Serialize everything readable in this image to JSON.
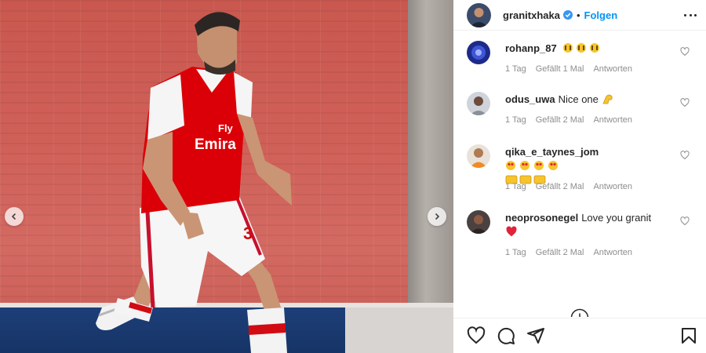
{
  "post": {
    "username": "granitxhaka",
    "follow_label": "Folgen",
    "separator": "•"
  },
  "comments": [
    {
      "username": "rohanp_87",
      "text": "",
      "emoji": [
        "face-with-open-hands",
        "face-with-open-hands",
        "face-with-open-hands"
      ],
      "time": "1 Tag",
      "likes": "Gefällt 1 Mal",
      "reply": "Antworten"
    },
    {
      "username": "odus_uwa",
      "text": "Nice one",
      "emoji": [
        "flexed-biceps"
      ],
      "time": "1 Tag",
      "likes": "Gefällt 2 Mal",
      "reply": "Antworten"
    },
    {
      "username": "qika_e_taynes_jom",
      "text": "",
      "emoji": [
        "heart-eyes",
        "heart-eyes",
        "heart-eyes",
        "heart-eyes",
        "clapping",
        "clapping",
        "clapping"
      ],
      "time": "1 Tag",
      "likes": "Gefällt 2 Mal",
      "reply": "Antworten"
    },
    {
      "username": "neoprosonegel",
      "text": "Love you granit",
      "emoji": [
        "red-heart"
      ],
      "time": "1 Tag",
      "likes": "Gefällt 2 Mal",
      "reply": "Antworten"
    }
  ],
  "icons": {
    "verified": "verified-badge-icon",
    "more": "more-options-icon",
    "comment_like": "heart-outline-icon",
    "load_more": "plus-circle-icon",
    "like": "heart-icon",
    "comment": "comment-icon",
    "share": "share-icon",
    "save": "bookmark-icon",
    "carousel_prev": "chevron-left-icon",
    "carousel_next": "chevron-right-icon"
  },
  "colors": {
    "accent": "#0095f6",
    "text": "#262626",
    "meta": "#8e8e8e",
    "kit_red": "#db0007"
  }
}
